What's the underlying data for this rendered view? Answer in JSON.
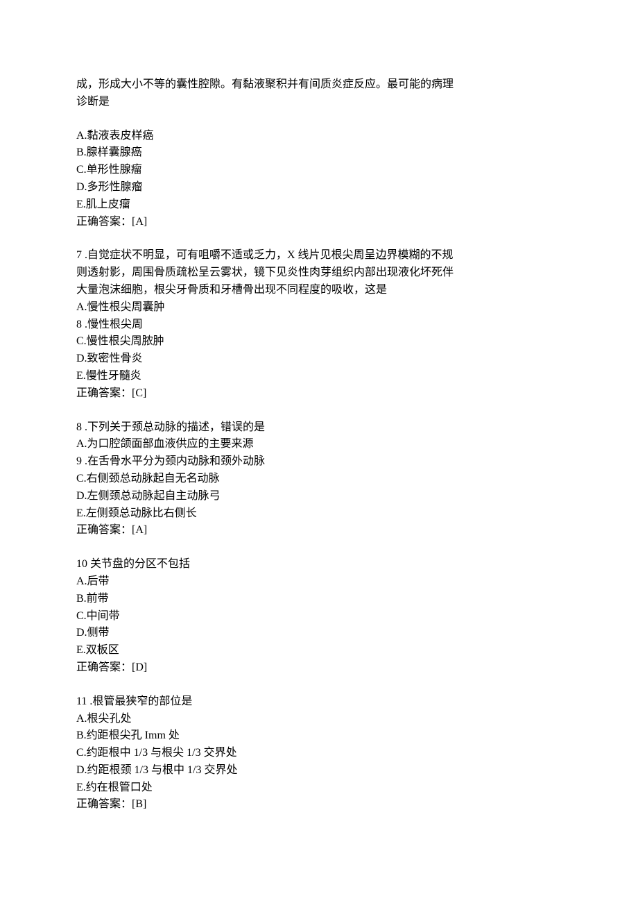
{
  "q6": {
    "stem_l1": "成，形成大小不等的囊性腔隙。有黏液聚积并有间质炎症反应。最可能的病理",
    "stem_l2": "诊断是",
    "optA": "A.黏液表皮样癌",
    "optB": "B.腺样囊腺癌",
    "optC": "C.单形性腺瘤",
    "optD": "D.多形性腺瘤",
    "optE": "E.肌上皮瘤",
    "ans": "正确答案：[A]"
  },
  "q7": {
    "stem_l1": "7 .自觉症状不明显，可有咀嚼不适或乏力，X 线片见根尖周呈边界模糊的不规",
    "stem_l2": "则透射影，周围骨质疏松呈云雾状，镜下见炎性肉芽组织内部出现液化坏死伴",
    "stem_l3": "大量泡沫细胞，根尖牙骨质和牙槽骨出现不同程度的吸收，这是",
    "optA": "A.慢性根尖周囊肿",
    "optB": "8 .慢性根尖周",
    "optC": "C.慢性根尖周脓肿",
    "optD": "D.致密性骨炎",
    "optE": "E.慢性牙髓炎",
    "ans": "正确答案：[C]"
  },
  "q8": {
    "stem": "8 .下列关于颈总动脉的描述，错误的是",
    "optA": "A.为口腔颌面部血液供应的主要来源",
    "optB": "9 .在舌骨水平分为颈内动脉和颈外动脉",
    "optC": "C.右侧颈总动脉起自无名动脉",
    "optD": "D.左侧颈总动脉起自主动脉弓",
    "optE": "E.左侧颈总动脉比右侧长",
    "ans": "正确答案：[A]"
  },
  "q10": {
    "stem": "10  关节盘的分区不包括",
    "optA": "A.后带",
    "optB": "B.前带",
    "optC": "C.中间带",
    "optD": "D.侧带",
    "optE": "E.双板区",
    "ans": "正确答案：[D]"
  },
  "q11": {
    "stem": "11 .根管最狭窄的部位是",
    "optA": "A.根尖孔处",
    "optB": "B.约距根尖孔 Imm 处",
    "optC": "C.约距根中 1/3 与根尖 1/3 交界处",
    "optD": "D.约距根颈 1/3 与根中 1/3 交界处",
    "optE": "E.约在根管口处",
    "ans": "正确答案：[B]"
  }
}
